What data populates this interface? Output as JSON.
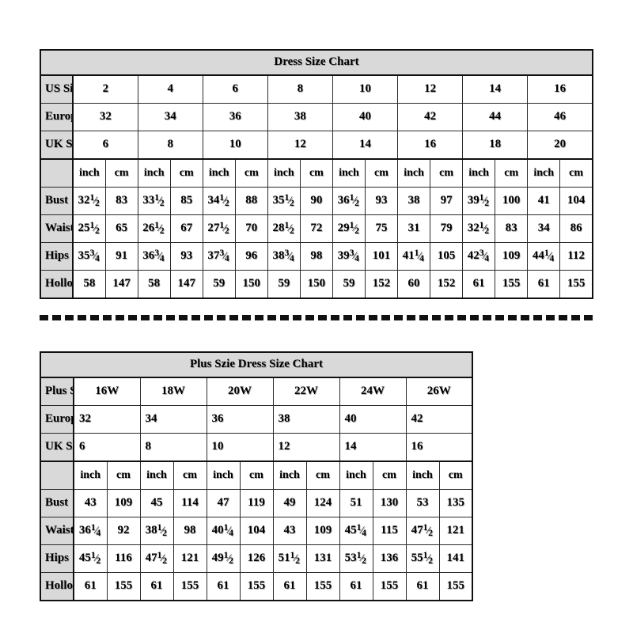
{
  "charts": [
    {
      "id": "dress-size-chart",
      "title": "Dress Size Chart",
      "size_rows": [
        {
          "label": "US Size",
          "values": [
            "2",
            "4",
            "6",
            "8",
            "10",
            "12",
            "14",
            "16"
          ]
        },
        {
          "label": "Europe Size",
          "values": [
            "32",
            "34",
            "36",
            "38",
            "40",
            "42",
            "44",
            "46"
          ]
        },
        {
          "label": "UK Size",
          "values": [
            "6",
            "8",
            "10",
            "12",
            "14",
            "16",
            "18",
            "20"
          ]
        }
      ],
      "unit_labels": [
        "inch",
        "cm"
      ],
      "measure_rows": [
        {
          "label": "Bust",
          "inch": [
            "32 1/2",
            "33 1/2",
            "34 1/2",
            "35 1/2",
            "36 1/2",
            "38",
            "39 1/2",
            "41"
          ],
          "cm": [
            "83",
            "85",
            "88",
            "90",
            "93",
            "97",
            "100",
            "104"
          ]
        },
        {
          "label": "Waist",
          "inch": [
            "25 1/2",
            "26 1/2",
            "27 1/2",
            "28 1/2",
            "29 1/2",
            "31",
            "32 1/2",
            "34"
          ],
          "cm": [
            "65",
            "67",
            "70",
            "72",
            "75",
            "79",
            "83",
            "86"
          ]
        },
        {
          "label": "Hips",
          "inch": [
            "35 3/4",
            "36 3/4",
            "37 3/4",
            "38 3/4",
            "39 3/4",
            "41 1/4",
            "42 3/4",
            "44 1/4"
          ],
          "cm": [
            "91",
            "93",
            "96",
            "98",
            "101",
            "105",
            "109",
            "112"
          ]
        },
        {
          "label": "Hollow to Floor",
          "inch": [
            "58",
            "58",
            "59",
            "59",
            "59",
            "60",
            "61",
            "61"
          ],
          "cm": [
            "147",
            "147",
            "150",
            "150",
            "152",
            "152",
            "155",
            "155"
          ]
        }
      ]
    },
    {
      "id": "plus-size-dress-size-chart",
      "title": "Plus Szie Dress Size Chart",
      "size_rows": [
        {
          "label": "Plus Szie (US)",
          "values": [
            "16W",
            "18W",
            "20W",
            "22W",
            "24W",
            "26W"
          ],
          "align": "center"
        },
        {
          "label": "Europe Size",
          "values": [
            "32",
            "34",
            "36",
            "38",
            "40",
            "42"
          ],
          "align": "left"
        },
        {
          "label": "UK Size",
          "values": [
            "6",
            "8",
            "10",
            "12",
            "14",
            "16"
          ],
          "align": "left"
        }
      ],
      "unit_labels": [
        "inch",
        "cm"
      ],
      "measure_rows": [
        {
          "label": "Bust",
          "inch": [
            "43",
            "45",
            "47",
            "49",
            "51",
            "53"
          ],
          "cm": [
            "109",
            "114",
            "119",
            "124",
            "130",
            "135"
          ]
        },
        {
          "label": "Waist",
          "inch": [
            "36 1/4",
            "38 1/2",
            "40 1/4",
            "43",
            "45 1/4",
            "47 1/2"
          ],
          "cm": [
            "92",
            "98",
            "104",
            "109",
            "115",
            "121"
          ]
        },
        {
          "label": "Hips",
          "inch": [
            "45 1/2",
            "47 1/2",
            "49 1/2",
            "51 1/2",
            "53 1/2",
            "55 1/2"
          ],
          "cm": [
            "116",
            "121",
            "126",
            "131",
            "136",
            "141"
          ]
        },
        {
          "label": "Hollow to Floor",
          "inch": [
            "61",
            "61",
            "61",
            "61",
            "61",
            "61"
          ],
          "cm": [
            "155",
            "155",
            "155",
            "155",
            "155",
            "155"
          ]
        }
      ]
    }
  ],
  "colors": {
    "header_bg": "#d9d9d9",
    "border": "#111111",
    "cell_bg": "#ffffff",
    "text": "#000000"
  }
}
